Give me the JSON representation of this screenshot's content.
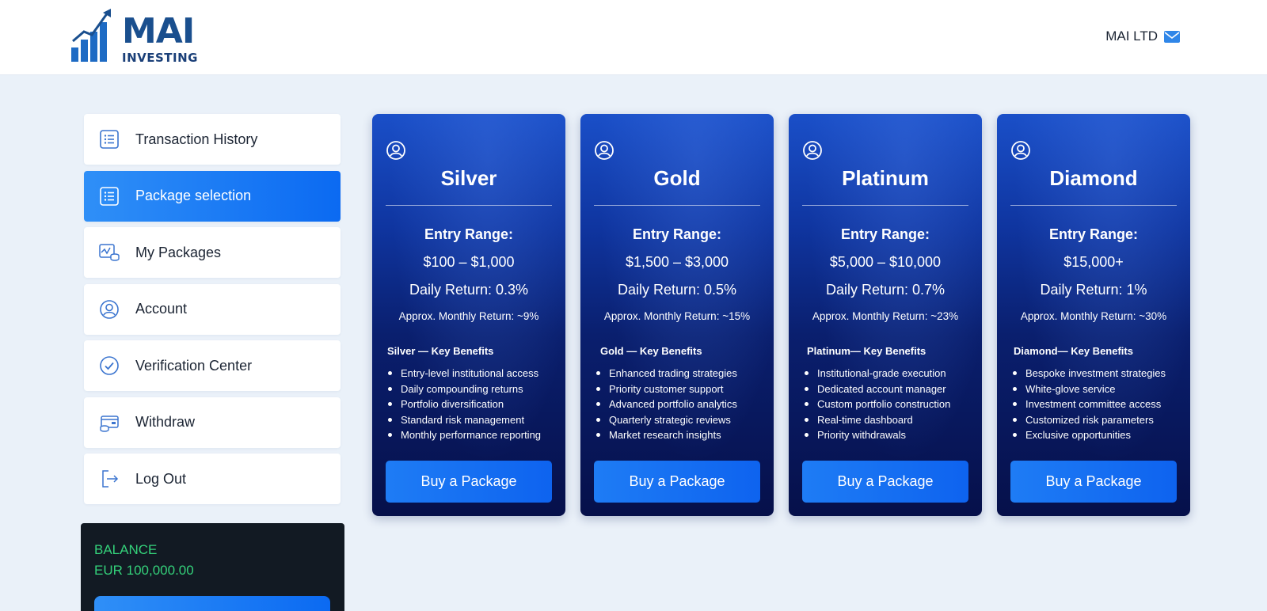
{
  "header": {
    "logo_main": "MAI",
    "logo_sub": "INVESTING",
    "company": "MAI LTD"
  },
  "sidebar": {
    "items": [
      {
        "label": "Transaction History",
        "icon": "list-icon",
        "active": false
      },
      {
        "label": "Package selection",
        "icon": "list-icon",
        "active": true
      },
      {
        "label": "My Packages",
        "icon": "chart-coins-icon",
        "active": false
      },
      {
        "label": "Account",
        "icon": "user-circle-icon",
        "active": false
      },
      {
        "label": "Verification Center",
        "icon": "check-circle-icon",
        "active": false
      },
      {
        "label": "Withdraw",
        "icon": "card-cash-icon",
        "active": false
      },
      {
        "label": "Log Out",
        "icon": "logout-icon",
        "active": false
      }
    ]
  },
  "balance": {
    "label": "BALANCE",
    "value": "EUR 100,000.00"
  },
  "packages": [
    {
      "name": "Silver",
      "entry_label": "Entry Range:",
      "range": "$100 – $1,000",
      "daily": "Daily Return: 0.3%",
      "monthly": "Approx. Monthly Return: ~9%",
      "benefits_title": "Silver — Key Benefits",
      "benefits": [
        "Entry-level institutional access",
        "Daily compounding returns",
        "Portfolio diversification",
        "Standard risk management",
        "Monthly performance reporting"
      ],
      "button": "Buy a Package"
    },
    {
      "name": "Gold",
      "entry_label": "Entry Range:",
      "range": "$1,500 – $3,000",
      "daily": "Daily Return: 0.5%",
      "monthly": "Approx. Monthly Return: ~15%",
      "benefits_title": "Gold — Key Benefits",
      "benefits": [
        "Enhanced trading strategies",
        "Priority customer support",
        "Advanced portfolio analytics",
        "Quarterly strategic reviews",
        "Market research insights"
      ],
      "button": "Buy a Package"
    },
    {
      "name": "Platinum",
      "entry_label": "Entry Range:",
      "range": "$5,000 – $10,000",
      "daily": "Daily Return: 0.7%",
      "monthly": "Approx. Monthly Return: ~23%",
      "benefits_title": "Platinum— Key Benefits",
      "benefits": [
        "Institutional-grade execution",
        "Dedicated account manager",
        "Custom portfolio construction",
        "Real-time dashboard",
        "Priority withdrawals"
      ],
      "button": "Buy a Package"
    },
    {
      "name": "Diamond",
      "entry_label": "Entry Range:",
      "range": "$15,000+",
      "daily": "Daily Return: 1%",
      "monthly": "Approx. Monthly Return: ~30%",
      "benefits_title": "Diamond— Key Benefits",
      "benefits": [
        "Bespoke investment strategies",
        "White-glove service",
        "Investment committee access",
        "Customized risk parameters",
        "Exclusive opportunities"
      ],
      "button": "Buy a Package"
    }
  ],
  "colors": {
    "accent": "#0b6af2",
    "balance_text": "#34d17a",
    "card_top": "#1a4fc8",
    "card_bottom": "#06104a"
  }
}
